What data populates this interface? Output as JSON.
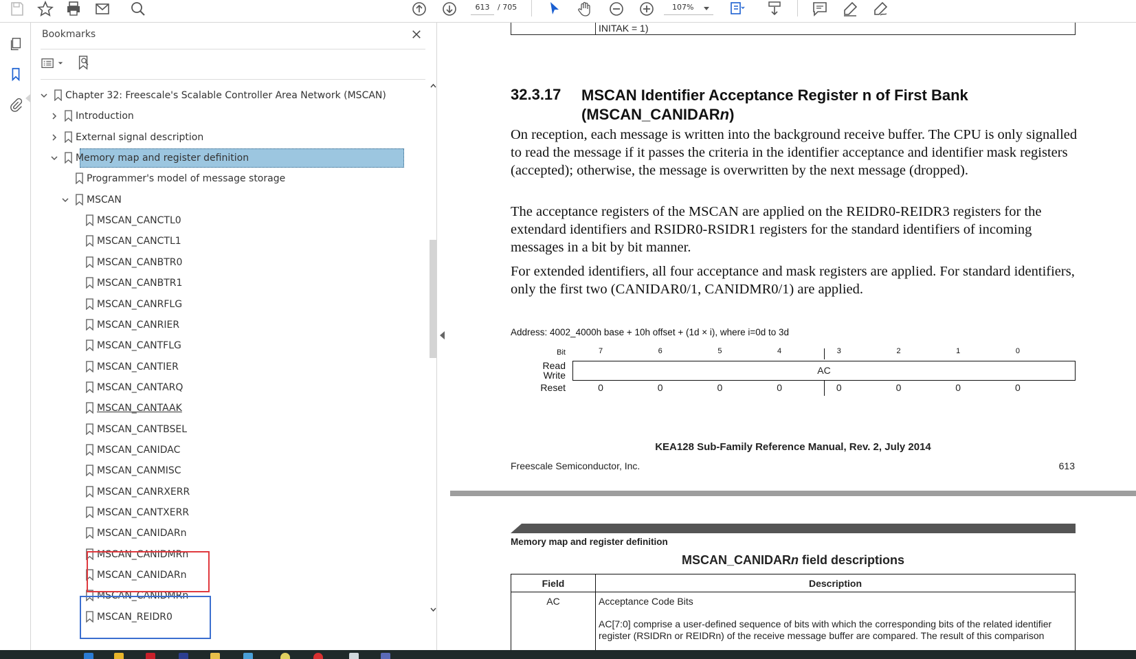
{
  "toolbar": {
    "page_current": "613",
    "page_total": "/ 705",
    "zoom": "107%",
    "icons": [
      "save-icon",
      "star-icon",
      "print-icon",
      "mail-icon",
      "find-icon",
      "page-up-icon",
      "page-down-icon",
      "select-arrow-icon",
      "hand-icon",
      "zoom-out-icon",
      "zoom-in-icon",
      "fit-icon",
      "scroll-icon",
      "comment-icon",
      "highlight-icon",
      "sign-icon"
    ]
  },
  "rail": {
    "icons": [
      "pages-icon",
      "bookmarks-icon",
      "attachments-icon"
    ]
  },
  "bookmarks": {
    "title": "Bookmarks",
    "items": [
      {
        "label": "Chapter 32: Freescale's Scalable Controller Area Network (MSCAN)",
        "level": 0,
        "expanded": true
      },
      {
        "label": "Introduction",
        "level": 1,
        "expanded": false
      },
      {
        "label": "External signal description",
        "level": 1,
        "expanded": false
      },
      {
        "label": "Memory map and register definition",
        "level": 1,
        "expanded": true,
        "selected": true
      },
      {
        "label": "Programmer's model of message storage",
        "level": 2
      },
      {
        "label": "MSCAN",
        "level": 2,
        "expanded": true
      },
      {
        "label": "MSCAN_CANCTL0",
        "level": 3
      },
      {
        "label": "MSCAN_CANCTL1",
        "level": 3
      },
      {
        "label": "MSCAN_CANBTR0",
        "level": 3
      },
      {
        "label": "MSCAN_CANBTR1",
        "level": 3
      },
      {
        "label": "MSCAN_CANRFLG",
        "level": 3
      },
      {
        "label": "MSCAN_CANRIER",
        "level": 3
      },
      {
        "label": "MSCAN_CANTFLG",
        "level": 3
      },
      {
        "label": "MSCAN_CANTIER",
        "level": 3
      },
      {
        "label": "MSCAN_CANTARQ",
        "level": 3
      },
      {
        "label": "MSCAN_CANTAAK",
        "level": 3,
        "hovered": true
      },
      {
        "label": "MSCAN_CANTBSEL",
        "level": 3
      },
      {
        "label": "MSCAN_CANIDAC",
        "level": 3
      },
      {
        "label": "MSCAN_CANMISC",
        "level": 3
      },
      {
        "label": "MSCAN_CANRXERR",
        "level": 3
      },
      {
        "label": "MSCAN_CANTXERR",
        "level": 3
      },
      {
        "label": "MSCAN_CANIDARn",
        "level": 3
      },
      {
        "label": "MSCAN_CANIDMRn",
        "level": 3
      },
      {
        "label": "MSCAN_CANIDARn",
        "level": 3
      },
      {
        "label": "MSCAN_CANIDMRn",
        "level": 3
      },
      {
        "label": "MSCAN_REIDR0",
        "level": 3
      }
    ]
  },
  "document": {
    "top_cell": "INITAK = 1)",
    "section_number": "32.3.17",
    "section_title_a": "MSCAN Identifier Acceptance Register n of First Bank",
    "section_title_b": "(MSCAN_CANIDAR",
    "section_title_n": "n",
    "section_title_c": ")",
    "para1": "On reception, each message is written into the background receive buffer. The CPU is only signalled to read the message if it passes the criteria in the identifier acceptance and identifier mask registers (accepted); otherwise, the message is overwritten by the next message (dropped).",
    "para2": "The acceptance registers of the MSCAN are applied on the REIDR0-REIDR3 registers for the extendard identifiers and RSIDR0-RSIDR1 registers for the standard identifiers of incoming messages in a bit by bit manner.",
    "para3": "For extended identifiers, all four acceptance and mask registers are applied. For standard identifiers, only the first two (CANIDAR0/1, CANIDMR0/1) are applied.",
    "address": "Address: 4002_4000h base + 10h offset + (1d × i), where i=0d to 3d",
    "register": {
      "bit_label": "Bit",
      "bits": [
        "7",
        "6",
        "5",
        "4",
        "3",
        "2",
        "1",
        "0"
      ],
      "read_label": "Read",
      "write_label": "Write",
      "field": "AC",
      "reset_label": "Reset",
      "reset": [
        "0",
        "0",
        "0",
        "0",
        "0",
        "0",
        "0",
        "0"
      ]
    },
    "footer_title": "KEA128 Sub-Family Reference Manual, Rev. 2, July 2014",
    "footer_company": "Freescale Semiconductor, Inc.",
    "footer_page": "613",
    "page2": {
      "running_head": "Memory map and register definition",
      "table_title_a": "MSCAN_CANIDAR",
      "table_title_n": "n",
      "table_title_b": " field descriptions",
      "col_field": "Field",
      "col_description": "Description",
      "row_field": "AC",
      "row_desc_title": "Acceptance Code Bits",
      "row_desc_body": "AC[7:0] comprise a user-defined sequence of bits with which the corresponding bits of the related identifier register (RSIDRn or REIDRn) of the receive message buffer are compared. The result of this comparison"
    }
  },
  "colors": {
    "selection": "#9cc6e0",
    "accent_blue": "#1a73e8",
    "red_box": "#e0393e",
    "blue_box": "#3a6ecf"
  }
}
